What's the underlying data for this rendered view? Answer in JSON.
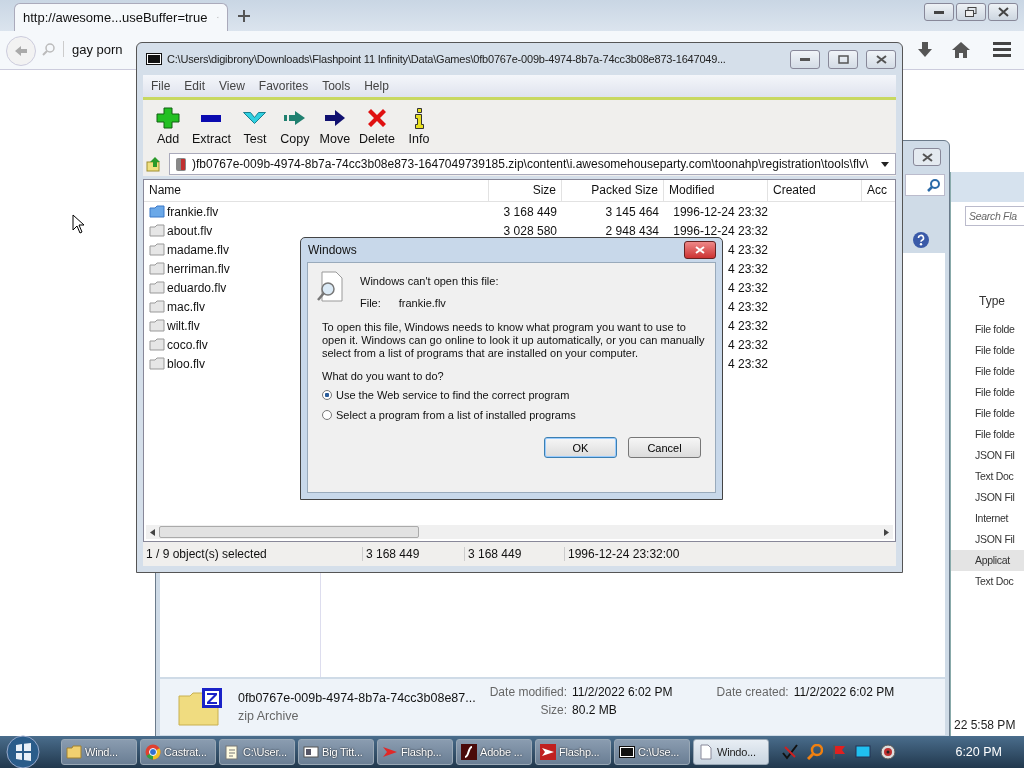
{
  "browser": {
    "tab_title": "http://awesome...useBuffer=true",
    "search_value": "gay porn"
  },
  "explorer": {
    "detail_name": "0fb0767e-009b-4974-8b7a-74cc3b08e87...",
    "detail_kind": "zip Archive",
    "modified_label": "Date modified:",
    "modified": "11/2/2022 6:02 PM",
    "size_label": "Size:",
    "size": "80.2 MB",
    "created_label": "Date created:",
    "created": "11/2/2022 6:02 PM"
  },
  "explorer_back": {
    "search_placeholder": "Search Fla",
    "type_header": "Type",
    "types": [
      {
        "label": "File folde",
        "selected": false
      },
      {
        "label": "File folde",
        "selected": false
      },
      {
        "label": "File folde",
        "selected": false
      },
      {
        "label": "File folde",
        "selected": false
      },
      {
        "label": "File folde",
        "selected": false
      },
      {
        "label": "File folde",
        "selected": false
      },
      {
        "label": "JSON Fil",
        "selected": false
      },
      {
        "label": "Text Doc",
        "selected": false
      },
      {
        "label": "JSON Fil",
        "selected": false
      },
      {
        "label": "Internet",
        "selected": false
      },
      {
        "label": "JSON Fil",
        "selected": false
      },
      {
        "label": "Applicat",
        "selected": true
      },
      {
        "label": "Text Doc",
        "selected": false
      }
    ],
    "time_fragment": "22 5:58 PM"
  },
  "archiver": {
    "title": "C:\\Users\\digibrony\\Downloads\\Flashpoint 11 Infinity\\Data\\Games\\0fb0767e-009b-4974-8b7a-74cc3b08e873-1647049...",
    "menu": [
      "File",
      "Edit",
      "View",
      "Favorites",
      "Tools",
      "Help"
    ],
    "toolbar": [
      {
        "label": "Add",
        "kind": "add"
      },
      {
        "label": "Extract",
        "kind": "extract"
      },
      {
        "label": "Test",
        "kind": "test"
      },
      {
        "label": "Copy",
        "kind": "copy"
      },
      {
        "label": "Move",
        "kind": "move"
      },
      {
        "label": "Delete",
        "kind": "delete"
      },
      {
        "label": "Info",
        "kind": "info"
      }
    ],
    "path": ")fb0767e-009b-4974-8b7a-74cc3b08e873-1647049739185.zip\\content\\i.awesomehouseparty.com\\toonahp\\registration\\tools\\flv\\",
    "columns": [
      "Name",
      "Size",
      "Packed Size",
      "Modified",
      "Created",
      "Acc"
    ],
    "files": [
      {
        "name": "frankie.flv",
        "size": "3 168 449",
        "packed": "3 145 464",
        "modified": "1996-12-24 23:32",
        "selected": true
      },
      {
        "name": "about.flv",
        "size": "3 028 580",
        "packed": "2 948 434",
        "modified": "1996-12-24 23:32",
        "selected": false
      },
      {
        "name": "madame.flv",
        "modified": "4 23:32",
        "selected": false
      },
      {
        "name": "herriman.flv",
        "modified": "4 23:32",
        "selected": false
      },
      {
        "name": "eduardo.flv",
        "modified": "4 23:32",
        "selected": false
      },
      {
        "name": "mac.flv",
        "modified": "4 23:32",
        "selected": false
      },
      {
        "name": "wilt.flv",
        "modified": "4 23:32",
        "selected": false
      },
      {
        "name": "coco.flv",
        "modified": "4 23:32",
        "selected": false
      },
      {
        "name": "bloo.flv",
        "modified": "4 23:32",
        "selected": false
      }
    ],
    "status": [
      "1 / 9 object(s) selected",
      "3 168 449",
      "3 168 449",
      "1996-12-24 23:32:00"
    ]
  },
  "dialog": {
    "title": "Windows",
    "heading": "Windows can't open this file:",
    "file_label": "File:",
    "file_name": "frankie.flv",
    "body": "To open this file, Windows needs to know what program you want to use to open it. Windows can go online to look it up automatically, or you can manually select from a list of programs that are installed on your computer.",
    "question": "What do you want to do?",
    "options": [
      {
        "label": "Use the Web service to find the correct program",
        "selected": true
      },
      {
        "label": "Select a program from a list of installed programs",
        "selected": false
      }
    ],
    "buttons": [
      {
        "label": "OK",
        "kind": "default"
      },
      {
        "label": "Cancel",
        "kind": "normal"
      }
    ]
  },
  "taskbar": {
    "items": [
      {
        "label": "Wind...",
        "kind": "explorer",
        "selected": false
      },
      {
        "label": "Castrat...",
        "kind": "chrome",
        "selected": false
      },
      {
        "label": "C:\\User...",
        "kind": "notepad",
        "selected": false
      },
      {
        "label": "Big Titt...",
        "kind": "image",
        "selected": false
      },
      {
        "label": "Flashp...",
        "kind": "flashpoint",
        "selected": false
      },
      {
        "label": "Adobe ...",
        "kind": "flash",
        "selected": false
      },
      {
        "label": "Flashp...",
        "kind": "flashpoint2",
        "selected": false
      },
      {
        "label": "C:\\Use...",
        "kind": "sevenzip",
        "selected": false
      },
      {
        "label": "Windo...",
        "kind": "document",
        "selected": true
      }
    ],
    "clock": "6:20 PM"
  }
}
